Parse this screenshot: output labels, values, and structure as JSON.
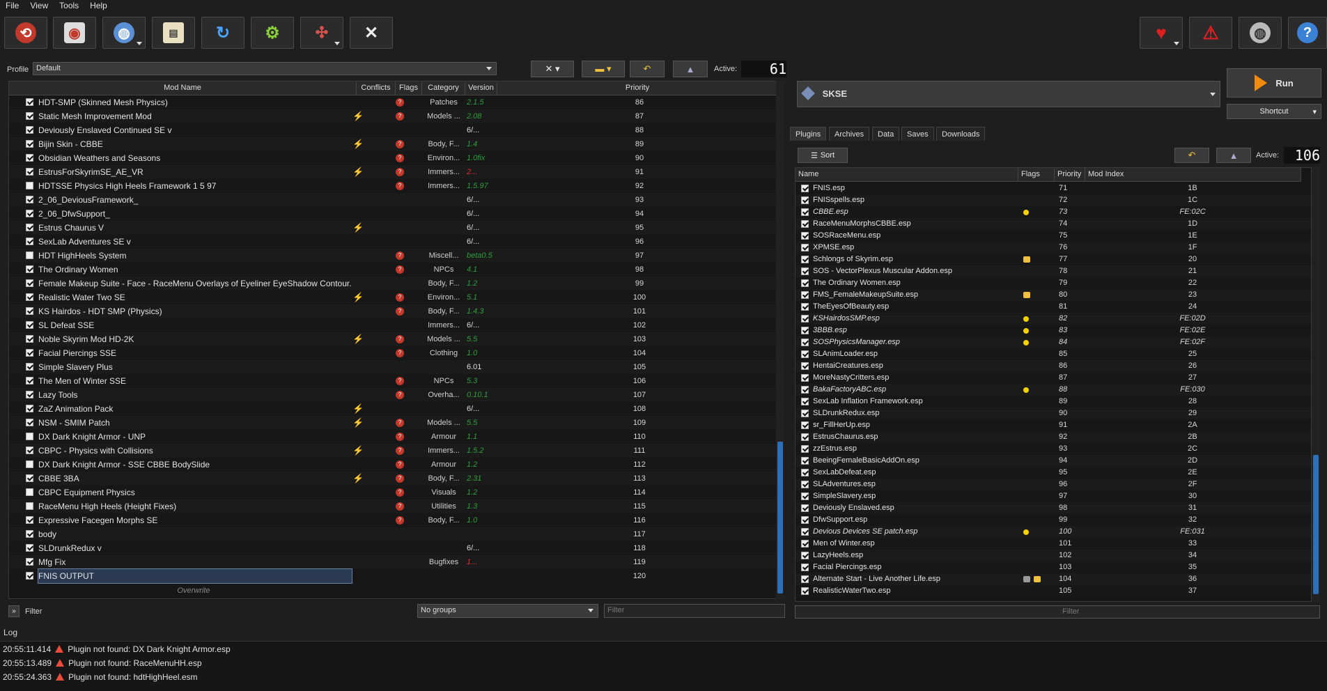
{
  "menu": [
    "File",
    "View",
    "Tools",
    "Help"
  ],
  "profile": {
    "label": "Profile",
    "value": "Default"
  },
  "active_label": "Active:",
  "active_mods": "61",
  "mod_headers": [
    "Mod Name",
    "Conflicts",
    "Flags",
    "Category",
    "Version",
    "Priority"
  ],
  "mods": [
    {
      "name": "HDT-SMP (Skinned Mesh Physics)",
      "on": true,
      "conflict": "",
      "flag": "red",
      "cat": "Patches",
      "ver": "2.1.5",
      "vc": "green",
      "pri": "86"
    },
    {
      "name": "Static Mesh Improvement Mod",
      "on": true,
      "conflict": "⚡",
      "flag": "red",
      "cat": "Models ...",
      "ver": "2.08",
      "vc": "green",
      "pri": "87"
    },
    {
      "name": "Deviously Enslaved Continued SE v",
      "on": true,
      "conflict": "",
      "flag": "",
      "cat": "",
      "ver": "6/...",
      "vc": "white",
      "pri": "88"
    },
    {
      "name": "Bijin Skin - CBBE",
      "on": true,
      "conflict": "⚡",
      "flag": "red",
      "cat": "Body, F...",
      "ver": "1.4",
      "vc": "green",
      "pri": "89"
    },
    {
      "name": "Obsidian Weathers and Seasons",
      "on": true,
      "conflict": "",
      "flag": "red",
      "cat": "Environ...",
      "ver": "1.0fix",
      "vc": "green",
      "pri": "90"
    },
    {
      "name": "EstrusForSkyrimSE_AE_VR",
      "on": true,
      "conflict": "⚡",
      "flag": "red",
      "cat": "Immers...",
      "ver": "2...",
      "vc": "red",
      "pri": "91"
    },
    {
      "name": "HDTSSE Physics High Heels Framework 1 5 97",
      "on": false,
      "conflict": "",
      "flag": "red",
      "cat": "Immers...",
      "ver": "1.5.97",
      "vc": "green",
      "pri": "92"
    },
    {
      "name": "2_06_DeviousFramework_",
      "on": true,
      "conflict": "",
      "flag": "",
      "cat": "",
      "ver": "6/...",
      "vc": "white",
      "pri": "93"
    },
    {
      "name": "2_06_DfwSupport_",
      "on": true,
      "conflict": "",
      "flag": "",
      "cat": "",
      "ver": "6/...",
      "vc": "white",
      "pri": "94"
    },
    {
      "name": "Estrus Chaurus V",
      "on": true,
      "conflict": "⚡",
      "flag": "",
      "cat": "",
      "ver": "6/...",
      "vc": "white",
      "pri": "95"
    },
    {
      "name": "SexLab Adventures SE v",
      "on": true,
      "conflict": "",
      "flag": "",
      "cat": "",
      "ver": "6/...",
      "vc": "white",
      "pri": "96"
    },
    {
      "name": "HDT HighHeels System",
      "on": false,
      "conflict": "",
      "flag": "red",
      "cat": "Miscell...",
      "ver": "beta0.5",
      "vc": "green",
      "pri": "97"
    },
    {
      "name": "The Ordinary Women",
      "on": true,
      "conflict": "",
      "flag": "red",
      "cat": "NPCs",
      "ver": "4.1",
      "vc": "green",
      "pri": "98"
    },
    {
      "name": "Female Makeup Suite - Face - RaceMenu Overlays of Eyeliner EyeShadow Contour...",
      "on": true,
      "conflict": "",
      "flag": "",
      "cat": "Body, F...",
      "ver": "1.2",
      "vc": "green",
      "pri": "99"
    },
    {
      "name": "Realistic Water Two SE",
      "on": true,
      "conflict": "⚡",
      "flag": "red",
      "cat": "Environ...",
      "ver": "5.1",
      "vc": "green",
      "pri": "100"
    },
    {
      "name": "KS Hairdos - HDT SMP (Physics)",
      "on": true,
      "conflict": "",
      "flag": "red",
      "cat": "Body, F...",
      "ver": "1.4.3",
      "vc": "green",
      "pri": "101"
    },
    {
      "name": "SL Defeat SSE",
      "on": true,
      "conflict": "",
      "flag": "",
      "cat": "Immers...",
      "ver": "6/...",
      "vc": "white",
      "pri": "102"
    },
    {
      "name": "Noble Skyrim Mod HD-2K",
      "on": true,
      "conflict": "⚡",
      "flag": "red",
      "cat": "Models ...",
      "ver": "5.5",
      "vc": "green",
      "pri": "103"
    },
    {
      "name": "Facial Piercings SSE",
      "on": true,
      "conflict": "",
      "flag": "red",
      "cat": "Clothing",
      "ver": "1.0",
      "vc": "green",
      "pri": "104"
    },
    {
      "name": "Simple Slavery Plus",
      "on": true,
      "conflict": "",
      "flag": "",
      "cat": "",
      "ver": "6.01",
      "vc": "white",
      "pri": "105"
    },
    {
      "name": "The Men of Winter SSE",
      "on": true,
      "conflict": "",
      "flag": "red",
      "cat": "NPCs",
      "ver": "5.3",
      "vc": "green",
      "pri": "106"
    },
    {
      "name": "Lazy Tools",
      "on": true,
      "conflict": "",
      "flag": "red",
      "cat": "Overha...",
      "ver": "0.10.1",
      "vc": "green",
      "pri": "107"
    },
    {
      "name": "ZaZ Animation Pack",
      "on": true,
      "conflict": "⚡",
      "flag": "",
      "cat": "",
      "ver": "6/...",
      "vc": "white",
      "pri": "108"
    },
    {
      "name": "NSM - SMIM Patch",
      "on": true,
      "conflict": "⚡",
      "flag": "red",
      "cat": "Models ...",
      "ver": "5.5",
      "vc": "green",
      "pri": "109"
    },
    {
      "name": "DX Dark Knight Armor - UNP",
      "on": false,
      "conflict": "",
      "flag": "red",
      "cat": "Armour",
      "ver": "1.1",
      "vc": "green",
      "pri": "110"
    },
    {
      "name": "CBPC - Physics with Collisions",
      "on": true,
      "conflict": "⚡",
      "flag": "red",
      "cat": "Immers...",
      "ver": "1.5.2",
      "vc": "green",
      "pri": "111"
    },
    {
      "name": "DX Dark Knight Armor - SSE CBBE BodySlide",
      "on": false,
      "conflict": "",
      "flag": "red",
      "cat": "Armour",
      "ver": "1.2",
      "vc": "green",
      "pri": "112"
    },
    {
      "name": "CBBE 3BA",
      "on": true,
      "conflict": "⚡",
      "flag": "red",
      "cat": "Body, F...",
      "ver": "2.31",
      "vc": "green",
      "pri": "113"
    },
    {
      "name": "CBPC Equipment Physics",
      "on": false,
      "conflict": "",
      "flag": "red",
      "cat": "Visuals",
      "ver": "1.2",
      "vc": "green",
      "pri": "114"
    },
    {
      "name": "RaceMenu High Heels (Height Fixes)",
      "on": false,
      "conflict": "",
      "flag": "red",
      "cat": "Utilities",
      "ver": "1.3",
      "vc": "green",
      "pri": "115"
    },
    {
      "name": "Expressive Facegen Morphs SE",
      "on": true,
      "conflict": "",
      "flag": "red",
      "cat": "Body, F...",
      "ver": "1.0",
      "vc": "green",
      "pri": "116"
    },
    {
      "name": "body",
      "on": true,
      "conflict": "",
      "flag": "",
      "cat": "",
      "ver": "",
      "vc": "white",
      "pri": "117"
    },
    {
      "name": "SLDrunkRedux v",
      "on": true,
      "conflict": "",
      "flag": "",
      "cat": "",
      "ver": "6/...",
      "vc": "white",
      "pri": "118"
    },
    {
      "name": "Mfg Fix",
      "on": true,
      "conflict": "",
      "flag": "",
      "cat": "Bugfixes",
      "ver": "1...",
      "vc": "red",
      "pri": "119"
    },
    {
      "name": "FNIS OUTPUT",
      "on": true,
      "conflict": "",
      "flag": "",
      "cat": "",
      "ver": "",
      "vc": "white",
      "pri": "120",
      "sel": true
    }
  ],
  "overwrite": "Overwrite",
  "filter_label": "Filter",
  "groups": "No groups",
  "filter_placeholder": "Filter",
  "executable": "SKSE",
  "run_label": "Run",
  "shortcut_label": "Shortcut",
  "tabs": [
    "Plugins",
    "Archives",
    "Data",
    "Saves",
    "Downloads"
  ],
  "sort_label": "Sort",
  "active_plugins": "106",
  "plugin_headers": [
    "Name",
    "Flags",
    "Priority",
    "Mod Index"
  ],
  "plugins": [
    {
      "name": "FNIS.esp",
      "pri": "71",
      "idx": "1B"
    },
    {
      "name": "FNISspells.esp",
      "pri": "72",
      "idx": "1C"
    },
    {
      "name": "CBBE.esp",
      "pri": "73",
      "idx": "FE:02C",
      "it": true,
      "flag": "dot"
    },
    {
      "name": "RaceMenuMorphsCBBE.esp",
      "pri": "74",
      "idx": "1D"
    },
    {
      "name": "SOSRaceMenu.esp",
      "pri": "75",
      "idx": "1E"
    },
    {
      "name": "XPMSE.esp",
      "pri": "76",
      "idx": "1F"
    },
    {
      "name": "Schlongs of Skyrim.esp",
      "pri": "77",
      "idx": "20",
      "flag": "box"
    },
    {
      "name": "SOS - VectorPlexus Muscular Addon.esp",
      "pri": "78",
      "idx": "21"
    },
    {
      "name": "The Ordinary Women.esp",
      "pri": "79",
      "idx": "22"
    },
    {
      "name": "FMS_FemaleMakeupSuite.esp",
      "pri": "80",
      "idx": "23",
      "flag": "box"
    },
    {
      "name": "TheEyesOfBeauty.esp",
      "pri": "81",
      "idx": "24"
    },
    {
      "name": "KSHairdosSMP.esp",
      "pri": "82",
      "idx": "FE:02D",
      "it": true,
      "flag": "dot"
    },
    {
      "name": "3BBB.esp",
      "pri": "83",
      "idx": "FE:02E",
      "it": true,
      "flag": "dot"
    },
    {
      "name": "SOSPhysicsManager.esp",
      "pri": "84",
      "idx": "FE:02F",
      "it": true,
      "flag": "dot"
    },
    {
      "name": "SLAnimLoader.esp",
      "pri": "85",
      "idx": "25"
    },
    {
      "name": "HentaiCreatures.esp",
      "pri": "86",
      "idx": "26"
    },
    {
      "name": "MoreNastyCritters.esp",
      "pri": "87",
      "idx": "27"
    },
    {
      "name": "BakaFactoryABC.esp",
      "pri": "88",
      "idx": "FE:030",
      "it": true,
      "flag": "dot"
    },
    {
      "name": "SexLab Inflation Framework.esp",
      "pri": "89",
      "idx": "28"
    },
    {
      "name": "SLDrunkRedux.esp",
      "pri": "90",
      "idx": "29"
    },
    {
      "name": "sr_FillHerUp.esp",
      "pri": "91",
      "idx": "2A"
    },
    {
      "name": "EstrusChaurus.esp",
      "pri": "92",
      "idx": "2B"
    },
    {
      "name": "zzEstrus.esp",
      "pri": "93",
      "idx": "2C"
    },
    {
      "name": "BeeingFemaleBasicAddOn.esp",
      "pri": "94",
      "idx": "2D"
    },
    {
      "name": "SexLabDefeat.esp",
      "pri": "95",
      "idx": "2E"
    },
    {
      "name": "SLAdventures.esp",
      "pri": "96",
      "idx": "2F"
    },
    {
      "name": "SimpleSlavery.esp",
      "pri": "97",
      "idx": "30"
    },
    {
      "name": "Deviously Enslaved.esp",
      "pri": "98",
      "idx": "31"
    },
    {
      "name": "DfwSupport.esp",
      "pri": "99",
      "idx": "32"
    },
    {
      "name": "Devious Devices SE patch.esp",
      "pri": "100",
      "idx": "FE:031",
      "it": true,
      "flag": "dot"
    },
    {
      "name": "Men of Winter.esp",
      "pri": "101",
      "idx": "33"
    },
    {
      "name": "LazyHeels.esp",
      "pri": "102",
      "idx": "34"
    },
    {
      "name": "Facial Piercings.esp",
      "pri": "103",
      "idx": "35"
    },
    {
      "name": "Alternate Start - Live Another Life.esp",
      "pri": "104",
      "idx": "36",
      "flag": "box2"
    },
    {
      "name": "RealisticWaterTwo.esp",
      "pri": "105",
      "idx": "37"
    }
  ],
  "plugin_filter": "Filter",
  "log_title": "Log",
  "log": [
    {
      "time": "20:55:11.414",
      "msg": "Plugin not found: DX Dark Knight Armor.esp"
    },
    {
      "time": "20:55:13.489",
      "msg": "Plugin not found: RaceMenuHH.esp"
    },
    {
      "time": "20:55:24.363",
      "msg": "Plugin not found: hdtHighHeel.esm"
    }
  ]
}
